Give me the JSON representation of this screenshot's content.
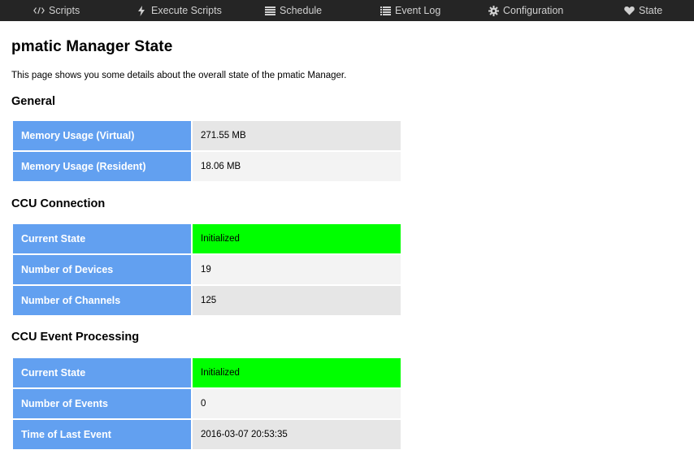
{
  "nav": {
    "items": [
      {
        "label": "Scripts",
        "icon": "code-icon"
      },
      {
        "label": "Execute Scripts",
        "icon": "bolt-icon"
      },
      {
        "label": "Schedule",
        "icon": "list-icon"
      },
      {
        "label": "Event Log",
        "icon": "list-icon"
      },
      {
        "label": "Configuration",
        "icon": "gear-icon"
      },
      {
        "label": "State",
        "icon": "heart-icon"
      }
    ]
  },
  "page": {
    "title": "pmatic Manager State",
    "intro": "This page shows you some details about the overall state of the pmatic Manager."
  },
  "sections": [
    {
      "title": "General",
      "rows": [
        {
          "label": "Memory Usage (Virtual)",
          "value": "271.55 MB"
        },
        {
          "label": "Memory Usage (Resident)",
          "value": "18.06 MB"
        }
      ]
    },
    {
      "title": "CCU Connection",
      "rows": [
        {
          "label": "Current State",
          "value": "Initialized"
        },
        {
          "label": "Number of Devices",
          "value": "19"
        },
        {
          "label": "Number of Channels",
          "value": "125"
        }
      ]
    },
    {
      "title": "CCU Event Processing",
      "rows": [
        {
          "label": "Current State",
          "value": "Initialized"
        },
        {
          "label": "Number of Events",
          "value": "0"
        },
        {
          "label": "Time of Last Event",
          "value": "2016-03-07 20:53:35"
        }
      ]
    }
  ],
  "colors": {
    "navbar": "#252525",
    "label_bg": "#62a0f0",
    "state_ok": "#00ff00"
  }
}
